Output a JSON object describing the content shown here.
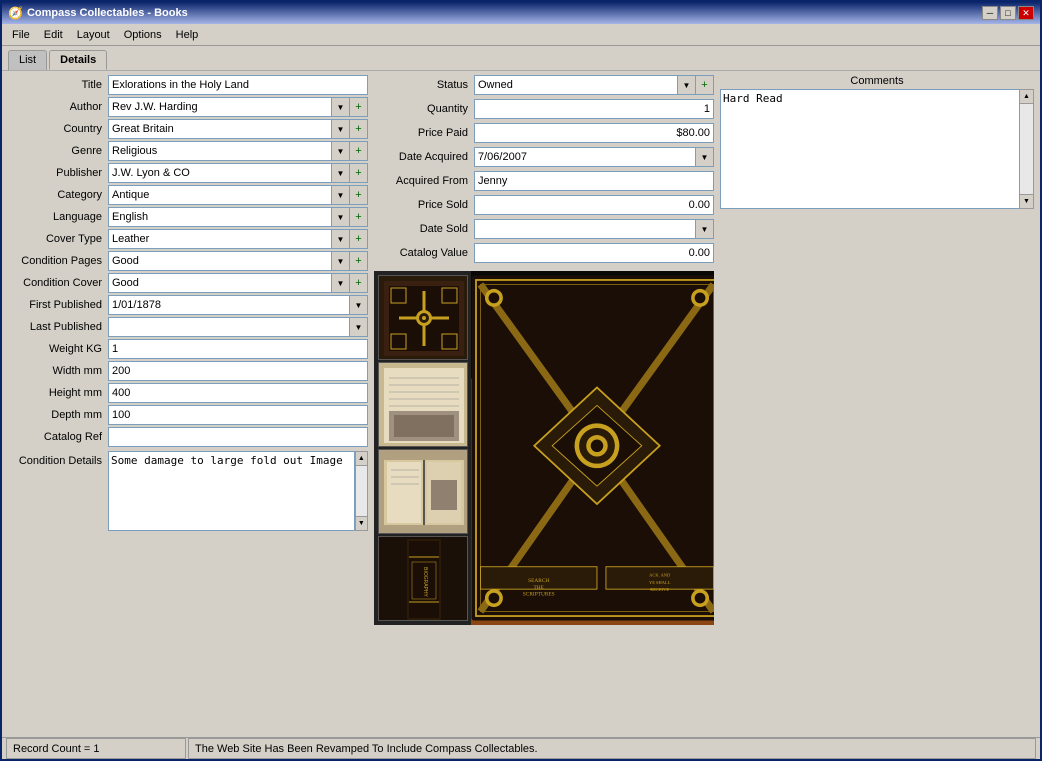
{
  "window": {
    "title": "Compass Collectables - Books",
    "icon": "🧭"
  },
  "titlebar": {
    "minimize": "─",
    "maximize": "□",
    "close": "✕"
  },
  "menu": {
    "items": [
      "File",
      "Edit",
      "Layout",
      "Options",
      "Help"
    ]
  },
  "tabs": {
    "list_label": "List",
    "detail_label": "Details"
  },
  "form": {
    "title_label": "Title",
    "title_value": "Exlorations in the Holy Land",
    "author_label": "Author",
    "author_value": "Rev J.W. Harding",
    "country_label": "Country",
    "country_value": "Great Britain",
    "genre_label": "Genre",
    "genre_value": "Religious",
    "publisher_label": "Publisher",
    "publisher_value": "J.W. Lyon & CO",
    "category_label": "Category",
    "category_value": "Antique",
    "language_label": "Language",
    "language_value": "English",
    "cover_type_label": "Cover Type",
    "cover_type_value": "Leather",
    "condition_pages_label": "Condition Pages",
    "condition_pages_value": "Good",
    "condition_cover_label": "Condition Cover",
    "condition_cover_value": "Good",
    "first_published_label": "First Published",
    "first_published_value": "1/01/1878",
    "last_published_label": "Last Published",
    "last_published_value": "",
    "weight_kg_label": "Weight KG",
    "weight_kg_value": "1",
    "width_mm_label": "Width mm",
    "width_mm_value": "200",
    "height_mm_label": "Height mm",
    "height_mm_value": "400",
    "depth_mm_label": "Depth mm",
    "depth_mm_value": "100",
    "catalog_ref_label": "Catalog Ref",
    "catalog_ref_value": "",
    "condition_details_label": "Condition Details",
    "condition_details_value": "Some damage to large fold out Image"
  },
  "middle": {
    "status_label": "Status",
    "status_value": "Owned",
    "quantity_label": "Quantity",
    "quantity_value": "1",
    "price_paid_label": "Price Paid",
    "price_paid_value": "$80.00",
    "date_acquired_label": "Date Acquired",
    "date_acquired_value": "7/06/2007",
    "acquired_from_label": "Acquired From",
    "acquired_from_value": "Jenny",
    "price_sold_label": "Price Sold",
    "price_sold_value": "0.00",
    "date_sold_label": "Date Sold",
    "date_sold_value": "",
    "catalog_value_label": "Catalog Value",
    "catalog_value_value": "0.00"
  },
  "comments": {
    "label": "Comments",
    "value": "Hard Read"
  },
  "status_bar": {
    "left": "Record Count = 1",
    "right": "The Web Site Has Been Revamped To Include Compass Collectables."
  }
}
